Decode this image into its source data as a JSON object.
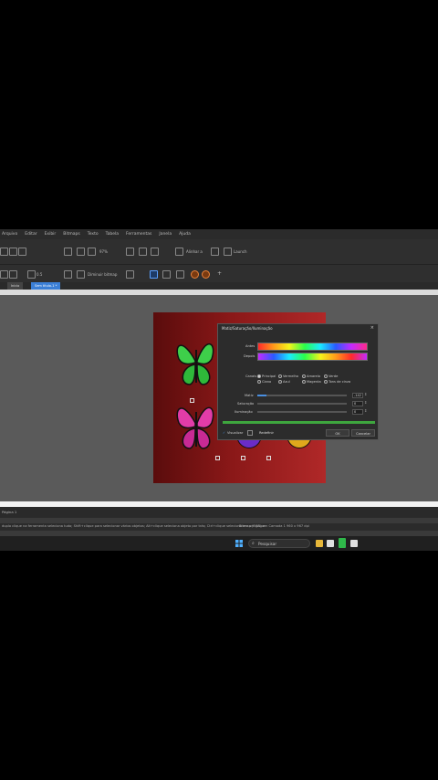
{
  "menu": [
    "Arquivo",
    "Editar",
    "Exibir",
    "Bitmaps",
    "Texto",
    "Tabela",
    "Ferramentas",
    "Janela",
    "Ajuda"
  ],
  "toolbar": {
    "zoom": "97%",
    "snap_label": "Alinhar a",
    "launch_label": "Launch",
    "field_value": "0.5",
    "wireframe_label": "Diminuir bitmap"
  },
  "tabs": [
    "Inicio",
    "Sem titulo-1 *"
  ],
  "dialog": {
    "title": "Matiz/Saturação/Iluminação",
    "close": "×",
    "before_label": "Antes",
    "after_label": "Depois",
    "channels_label": "Canais",
    "channels": [
      {
        "top": "Principal",
        "bottom": "Ciano"
      },
      {
        "top": "Vermelho",
        "bottom": "Azul"
      },
      {
        "top": "Amarelo",
        "bottom": "Magenta"
      },
      {
        "top": "Verde",
        "bottom": "Tons de cinza"
      }
    ],
    "hue_label": "Matiz",
    "hue_value": "-142",
    "hue_level": 0.1,
    "saturation_label": "Saturação",
    "saturation_value": "0",
    "lightness_label": "Iluminação",
    "lightness_value": "0",
    "preview_label": "Visualizar",
    "reset_label": "Redefinir",
    "ok_label": "OK",
    "cancel_label": "Cancelar"
  },
  "page_tab": "Página 1",
  "status": {
    "hint": "duplo clique na ferramenta seleciona tudo; Shift+clique para selecionar vários objetos; Alt+clique seleciona objeto por trás; Ctrl+clique seleciona em um grupo",
    "info": "Bitmap (RGB) em Camada 1 960 x 967 dpi"
  },
  "taskbar": {
    "search_placeholder": "Pesquisar"
  },
  "colors": {
    "accent": "#3b7fd6",
    "artboard": "#8a1818",
    "progress": "#3ea63e"
  }
}
